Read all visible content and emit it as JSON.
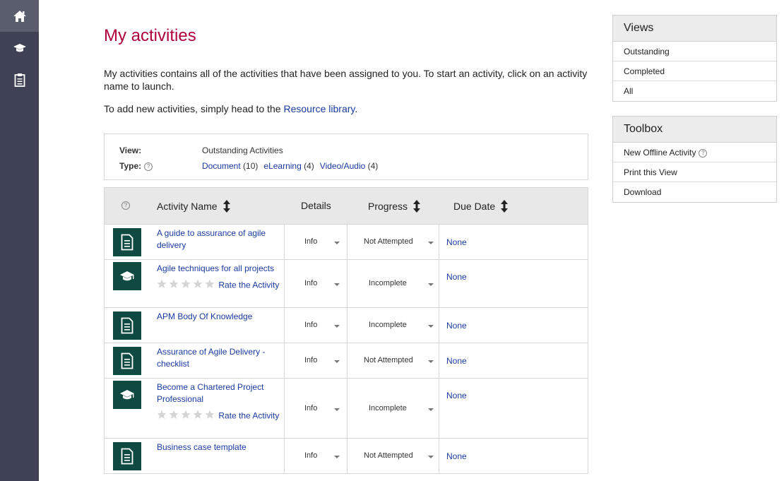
{
  "page": {
    "title": "My activities",
    "intro": "My activities contains all of the activities that have been assigned to you. To start an activity, click on an activity name to launch.",
    "intro2_prefix": "To add new activities, simply head to the ",
    "intro2_link": "Resource library",
    "intro2_suffix": "."
  },
  "filters": {
    "view_label": "View:",
    "view_value": "Outstanding Activities",
    "type_label": "Type:",
    "help_glyph": "?",
    "types": [
      {
        "label": "Document",
        "count": "(10)"
      },
      {
        "label": "eLearning",
        "count": "(4)"
      },
      {
        "label": "Video/Audio",
        "count": "(4)"
      }
    ]
  },
  "table": {
    "help_glyph": "?",
    "headers": {
      "name": "Activity Name",
      "details": "Details",
      "progress": "Progress",
      "due": "Due Date"
    },
    "rows": [
      {
        "icon": "document-icon",
        "name": "A guide to assurance of agile delivery",
        "details": "Info",
        "progress": "Not Attempted",
        "due": "None",
        "rate": ""
      },
      {
        "icon": "graduation-cap-icon",
        "name": "Agile techniques for all projects",
        "details": "Info",
        "progress": "Incomplete",
        "due": "None",
        "rate": "Rate the Activity"
      },
      {
        "icon": "document-icon",
        "name": "APM Body Of Knowledge",
        "details": "Info",
        "progress": "Incomplete",
        "due": "None",
        "rate": ""
      },
      {
        "icon": "document-icon",
        "name": "Assurance of Agile Delivery - checklist",
        "details": "Info",
        "progress": "Not Attempted",
        "due": "None",
        "rate": ""
      },
      {
        "icon": "graduation-cap-icon",
        "name": "Become a Chartered Project Professional",
        "details": "Info",
        "progress": "Incomplete",
        "due": "None",
        "rate": "Rate the Activity"
      },
      {
        "icon": "document-icon",
        "name": "Business case template",
        "details": "Info",
        "progress": "Not Attempted",
        "due": "None",
        "rate": ""
      }
    ]
  },
  "views_panel": {
    "title": "Views",
    "items": [
      "Outstanding",
      "Completed",
      "All"
    ]
  },
  "toolbox_panel": {
    "title": "Toolbox",
    "items": [
      "New Offline Activity",
      "Print this View",
      "Download"
    ],
    "help_glyph": "?"
  },
  "colors": {
    "sidebar": "#3f4254",
    "title": "#b0003a",
    "link": "#1a3aa0",
    "icon_tile": "#0f4a42"
  },
  "nav_icons": [
    "home-icon",
    "graduation-cap-icon",
    "clipboard-icon"
  ]
}
